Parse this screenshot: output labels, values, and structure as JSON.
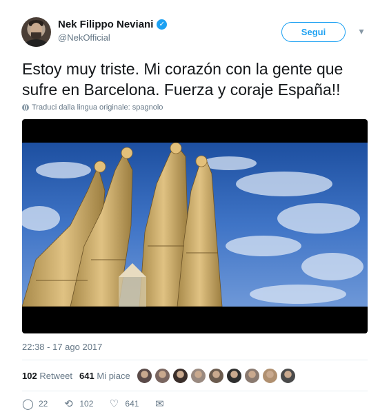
{
  "author": {
    "name": "Nek Filippo Neviani",
    "handle": "@NekOfficial",
    "verified_icon": "verified-badge-icon"
  },
  "header": {
    "follow_label": "Segui",
    "caret": "▾"
  },
  "tweet": {
    "text": "Estoy muy triste. Mi corazón con la gente que sufre en Barcelona. Fuerza y coraje España!!",
    "translation_note": "Traduci dalla lingua originale: spagnolo",
    "timestamp": "22:38 - 17 ago 2017"
  },
  "stats": {
    "retweets_count": "102",
    "retweets_label": "Retweet",
    "likes_count": "641",
    "likes_label": "Mi piace",
    "liker_colors": [
      "#5a4a48",
      "#7a6660",
      "#3a2e2a",
      "#9a8a80",
      "#6b5b4e",
      "#2e2e2e",
      "#8a7a70",
      "#b09070",
      "#4a4a4a"
    ]
  },
  "actions": {
    "reply_count": "22",
    "retweet_count": "102",
    "like_count": "641"
  },
  "colors": {
    "accent": "#1da1f2",
    "muted": "#657786"
  }
}
